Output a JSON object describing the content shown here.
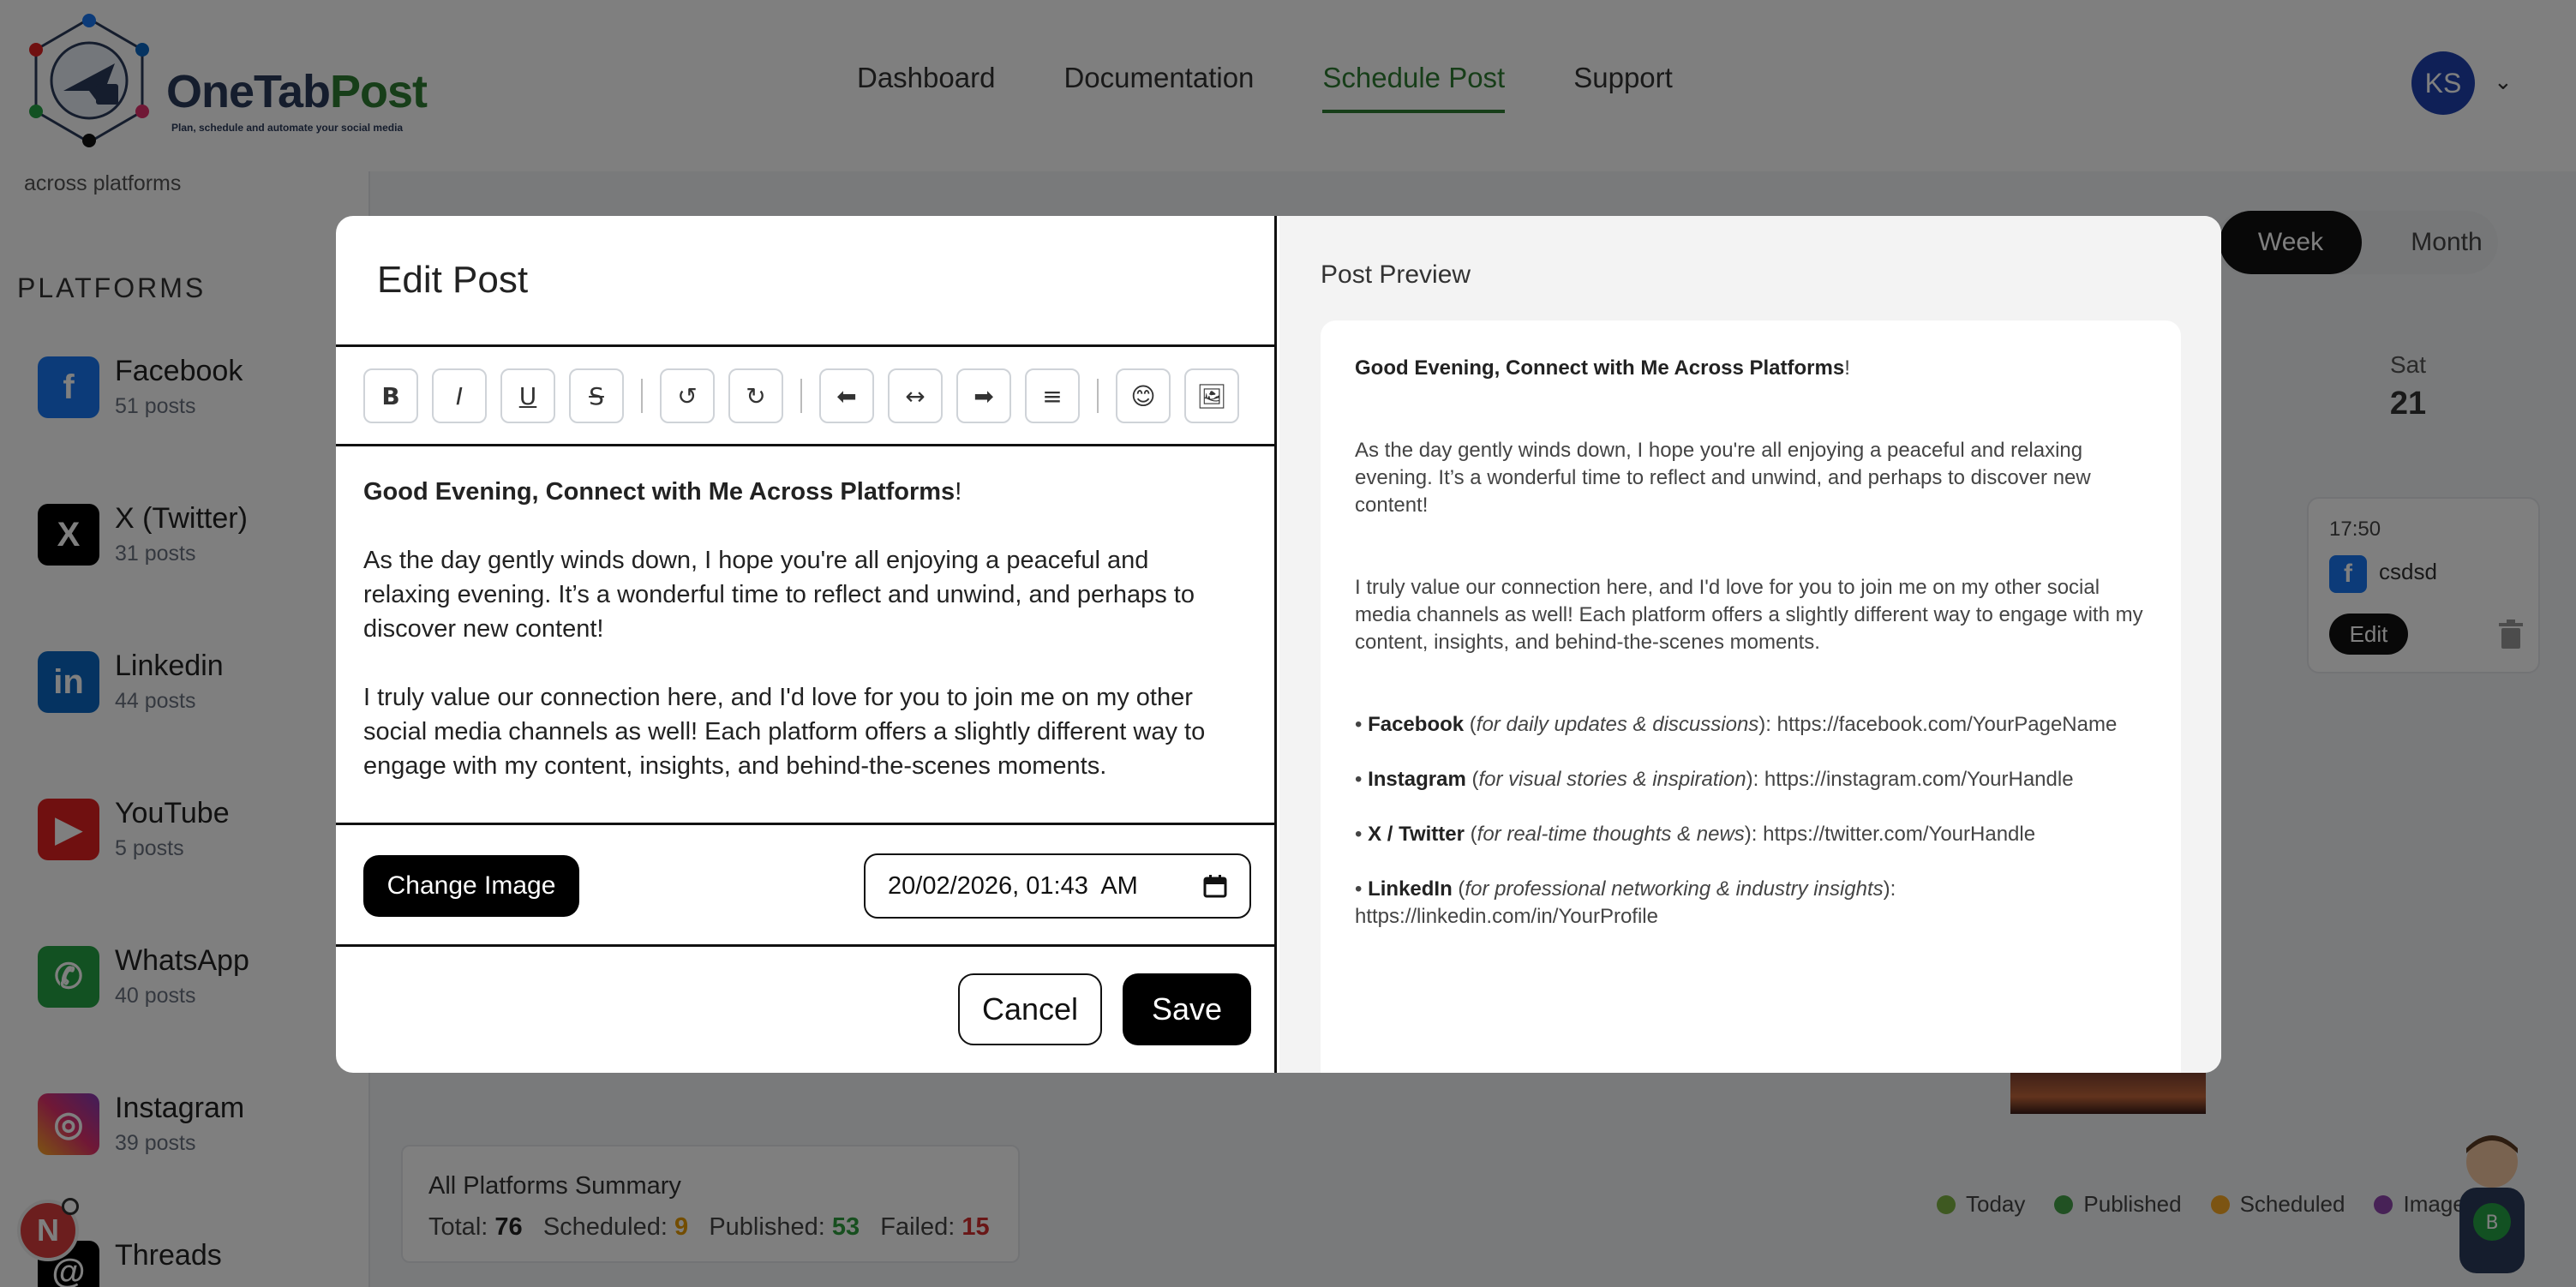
{
  "app": {
    "logo_title_main": "OneTab",
    "logo_title_accent": "Post",
    "logo_tagline": "Plan, schedule and automate your social media",
    "nav": [
      "Dashboard",
      "Documentation",
      "Schedule Post",
      "Support"
    ],
    "active_nav": "Schedule Post",
    "avatar_initials": "KS"
  },
  "sidebar": {
    "subtitle": "across platforms",
    "heading": "PLATFORMS",
    "platforms": [
      {
        "name": "Facebook",
        "count": "51 posts",
        "icon": "facebook-icon",
        "color": "#1877f2"
      },
      {
        "name": "X (Twitter)",
        "count": "31 posts",
        "icon": "x-icon",
        "color": "#000000"
      },
      {
        "name": "Linkedin",
        "count": "44 posts",
        "icon": "linkedin-icon",
        "color": "#0a66c2"
      },
      {
        "name": "YouTube",
        "count": "5 posts",
        "icon": "youtube-icon",
        "color": "#e02020"
      },
      {
        "name": "WhatsApp",
        "count": "40 posts",
        "icon": "whatsapp-icon",
        "color": "#25a244"
      },
      {
        "name": "Instagram",
        "count": "39 posts",
        "icon": "instagram-icon",
        "color": "#e1306c"
      },
      {
        "name": "Threads",
        "count": "",
        "icon": "threads-icon",
        "color": "#000000"
      }
    ]
  },
  "calendar": {
    "view_week": "Week",
    "view_month": "Month",
    "day_name": "Sat",
    "day_number": "21",
    "post_time": "17:50",
    "post_name": "csdsd",
    "post_edit": "Edit"
  },
  "summary": {
    "title": "All Platforms Summary",
    "total_label": "Total:",
    "total": "76",
    "scheduled_label": "Scheduled:",
    "scheduled": "9",
    "published_label": "Published:",
    "published": "53",
    "failed_label": "Failed:",
    "failed": "15"
  },
  "legend": [
    {
      "label": "Today",
      "color": "#7cb342"
    },
    {
      "label": "Published",
      "color": "#43a047"
    },
    {
      "label": "Scheduled",
      "color": "#f9a825"
    },
    {
      "label": "Image",
      "color": "#8e44ad"
    }
  ],
  "notification_badge": "N",
  "modal": {
    "title": "Edit Post",
    "toolbar": {
      "bold": "B",
      "italic": "I",
      "underline": "U",
      "strike": "S",
      "undo": "↺",
      "redo": "↻",
      "align_left": "⬅",
      "align_center": "↔",
      "align_right": "➡",
      "justify": "≡",
      "emoji": "😊",
      "image": "🖼"
    },
    "content": {
      "headline": "Good Evening, Connect with Me Across Platforms",
      "headline_suffix": "!",
      "para1": "As the day gently winds down, I hope you're all enjoying a peaceful and relaxing evening. It’s a wonderful time to reflect and unwind, and perhaps to discover new content!",
      "para2": "I truly value our connection here, and I'd love for you to join me on my other social media channels as well! Each platform offers a slightly different way to engage with my content, insights, and behind-the-scenes moments."
    },
    "change_image": "Change Image",
    "datetime": "20/02/2026, 01:43  AM",
    "cancel": "Cancel",
    "save": "Save"
  },
  "preview": {
    "title": "Post Preview",
    "headline": "Good Evening, Connect with Me Across Platforms",
    "headline_suffix": "!",
    "para1": "As the day gently winds down, I hope you're all enjoying a peaceful and relaxing evening. It’s a wonderful time to reflect and unwind, and perhaps to discover new content!",
    "para2": "I truly value our connection here, and I'd love for you to join me on my other social media channels as well! Each platform offers a slightly different way to engage with my content, insights, and behind-the-scenes moments.",
    "links": [
      {
        "name": "Facebook",
        "note": "for daily updates & discussions",
        "url": "https://facebook.com/YourPageName"
      },
      {
        "name": "Instagram",
        "note": "for visual stories & inspiration",
        "url": "https://instagram.com/YourHandle"
      },
      {
        "name": "X / Twitter",
        "note": "for real-time thoughts & news",
        "url": "https://twitter.com/YourHandle"
      },
      {
        "name": "LinkedIn",
        "note": "for professional networking & industry insights",
        "url": "https://linkedin.com/in/YourProfile"
      }
    ]
  }
}
